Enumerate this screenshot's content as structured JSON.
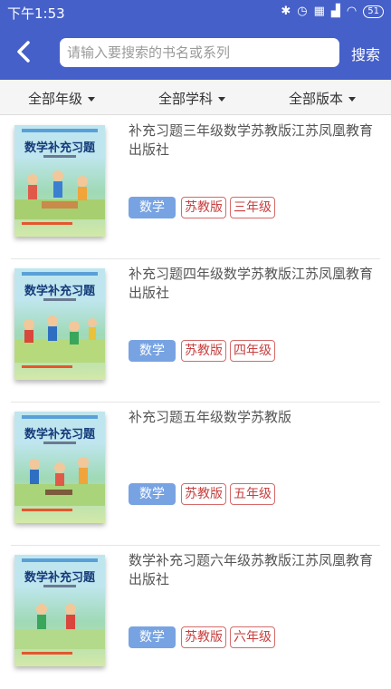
{
  "status_bar": {
    "time": "下午1:53",
    "icons": [
      "bluetooth-icon",
      "alarm-icon",
      "sim-icon",
      "signal-icon",
      "wifi-icon"
    ],
    "battery": "51"
  },
  "header": {
    "search_placeholder": "请输入要搜索的书名或系列",
    "search_label": "搜索",
    "background_color": "#4560c9"
  },
  "filters": [
    "全部年级",
    "全部学科",
    "全部版本"
  ],
  "books": [
    {
      "title": "补充习题三年级数学苏教版江苏凤凰教育出版社",
      "cover_title": "数学补充习题",
      "subject": "数学",
      "edition": "苏教版",
      "grade": "三年级"
    },
    {
      "title": "补充习题四年级数学苏教版江苏凤凰教育出版社",
      "cover_title": "数学补充习题",
      "subject": "数学",
      "edition": "苏教版",
      "grade": "四年级"
    },
    {
      "title": "补充习题五年级数学苏教版",
      "cover_title": "数学补充习题",
      "subject": "数学",
      "edition": "苏教版",
      "grade": "五年级"
    },
    {
      "title": "数学补充习题六年级苏教版江苏凤凰教育出版社",
      "cover_title": "数学补充习题",
      "subject": "数学",
      "edition": "苏教版",
      "grade": "六年级"
    }
  ],
  "colors": {
    "subject_tag": "#78a3e2",
    "outline_tag": "#d56a6a"
  }
}
